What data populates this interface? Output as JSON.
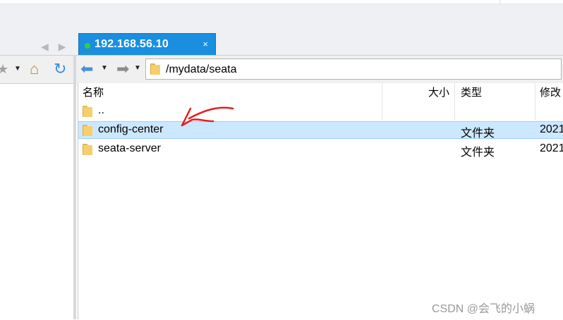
{
  "tab": {
    "title": "192.168.56.10",
    "close_glyph": "×",
    "status_color": "#36d036"
  },
  "tab_nav": {
    "back_glyph": "◀",
    "forward_glyph": "▶"
  },
  "left_toolbar": {
    "star_glyph": "★",
    "dropdown_glyph": "▼",
    "home_glyph": "⌂",
    "refresh_glyph": "↻"
  },
  "toolbar": {
    "back_glyph": "⬅",
    "forward_glyph": "➡",
    "dropdown_glyph": "▼",
    "path": "/mydata/seata"
  },
  "columns": {
    "name": "名称",
    "size": "大小",
    "type": "类型",
    "modified": "修改"
  },
  "files": [
    {
      "name": "..",
      "size": "",
      "type": "",
      "modified": ""
    },
    {
      "name": "config-center",
      "size": "",
      "type": "文件夹",
      "modified": "2021",
      "selected": true
    },
    {
      "name": "seata-server",
      "size": "",
      "type": "文件夹",
      "modified": "2021"
    }
  ],
  "watermark": "CSDN @会飞的小蜗",
  "annotation": {
    "color": "#e02020",
    "icon": "hand-drawn-arrow"
  }
}
